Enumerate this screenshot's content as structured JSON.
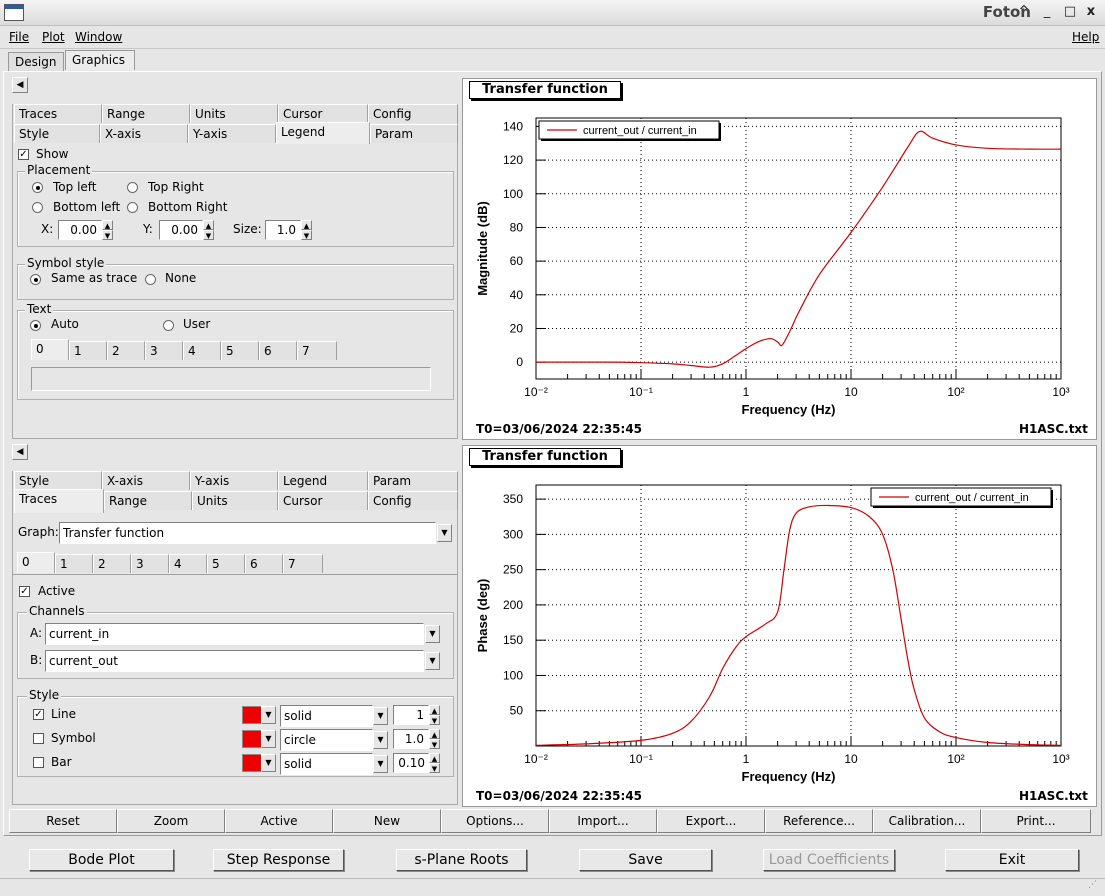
{
  "window": {
    "title": "Foton",
    "min_icon": "^",
    "minimize_icon": "_",
    "maximize_icon": "□",
    "close_icon": "x"
  },
  "menu": {
    "file": "File",
    "plot": "Plot",
    "window": "Window",
    "help": "Help"
  },
  "main_tabs": [
    "Design",
    "Graphics"
  ],
  "upper_options": {
    "tabs_row1": [
      "Traces",
      "Range",
      "Units",
      "Cursor",
      "Config"
    ],
    "tabs_row2": [
      "Style",
      "X-axis",
      "Y-axis",
      "Legend",
      "Param"
    ],
    "show_label": "Show",
    "placement": {
      "label": "Placement",
      "top_left": "Top left",
      "top_right": "Top Right",
      "bottom_left": "Bottom left",
      "bottom_right": "Bottom Right",
      "x_label": "X:",
      "x_value": "0.00",
      "y_label": "Y:",
      "y_value": "0.00",
      "size_label": "Size:",
      "size_value": "1.0"
    },
    "symbol_style": {
      "label": "Symbol style",
      "same": "Same as trace",
      "none": "None"
    },
    "text": {
      "label": "Text",
      "auto": "Auto",
      "user": "User",
      "tabs": [
        "0",
        "1",
        "2",
        "3",
        "4",
        "5",
        "6",
        "7"
      ]
    }
  },
  "lower_options": {
    "tabs_row1": [
      "Style",
      "X-axis",
      "Y-axis",
      "Legend",
      "Param"
    ],
    "tabs_row2": [
      "Traces",
      "Range",
      "Units",
      "Cursor",
      "Config"
    ],
    "graph_label": "Graph:",
    "graph_value": "Transfer function",
    "trace_tabs": [
      "0",
      "1",
      "2",
      "3",
      "4",
      "5",
      "6",
      "7"
    ],
    "active_label": "Active",
    "channels": {
      "label": "Channels",
      "a_label": "A:",
      "a_value": "current_in",
      "b_label": "B:",
      "b_value": "current_out"
    },
    "style": {
      "label": "Style",
      "line_label": "Line",
      "line_type": "solid",
      "line_width": "1",
      "symbol_label": "Symbol",
      "symbol_type": "circle",
      "symbol_size": "1.0",
      "bar_label": "Bar",
      "bar_type": "solid",
      "bar_width": "0.10"
    }
  },
  "plots": {
    "top": {
      "title": "Transfer function",
      "legend": "current_out / current_in",
      "ylabel": "Magnitude (dB)",
      "xlabel": "Frequency (Hz)",
      "t0": "T0=03/06/2024 22:35:45",
      "file": "H1ASC.txt"
    },
    "bottom": {
      "title": "Transfer function",
      "legend": "current_out / current_in",
      "ylabel": "Phase (deg)",
      "xlabel": "Frequency (Hz)",
      "t0": "T0=03/06/2024 22:35:45",
      "file": "H1ASC.txt"
    }
  },
  "chart_data": [
    {
      "type": "line",
      "xscale": "log",
      "xlim": [
        0.01,
        1000
      ],
      "ylim": [
        -10,
        145
      ],
      "yticks": [
        0,
        20,
        40,
        60,
        80,
        100,
        120,
        140
      ],
      "xticks": [
        "10⁻²",
        "10⁻¹",
        "1",
        "10",
        "10²",
        "10³"
      ],
      "grid": true,
      "legend_position": "top-left",
      "color": "#d40000",
      "series": [
        {
          "name": "current_out / current_in",
          "x": [
            0.01,
            0.05,
            0.1,
            0.2,
            0.3,
            0.45,
            0.6,
            0.8,
            1.0,
            1.3,
            1.7,
            2.0,
            2.2,
            2.6,
            3.2,
            5,
            10,
            20,
            35,
            45,
            60,
            100,
            200,
            500,
            1000
          ],
          "y": [
            0,
            0,
            -0.3,
            -1,
            -2,
            -3,
            -1,
            4,
            8,
            12,
            14,
            12,
            10,
            18,
            30,
            52,
            77,
            104,
            128,
            137,
            133,
            129,
            127,
            126.5,
            126.5
          ]
        }
      ]
    },
    {
      "type": "line",
      "xscale": "log",
      "xlim": [
        0.01,
        1000
      ],
      "ylim": [
        0,
        370
      ],
      "yticks": [
        50,
        100,
        150,
        200,
        250,
        300,
        350
      ],
      "xticks": [
        "10⁻²",
        "10⁻¹",
        "1",
        "10",
        "10²",
        "10³"
      ],
      "grid": true,
      "legend_position": "top-right",
      "color": "#d40000",
      "series": [
        {
          "name": "current_out / current_in",
          "x": [
            0.01,
            0.03,
            0.1,
            0.2,
            0.3,
            0.45,
            0.6,
            0.8,
            1.0,
            1.5,
            2.0,
            2.3,
            2.6,
            3.0,
            4,
            6,
            10,
            15,
            20,
            25,
            30,
            35,
            40,
            50,
            70,
            100,
            200,
            500,
            1000
          ],
          "y": [
            1,
            3,
            8,
            18,
            35,
            70,
            110,
            140,
            155,
            172,
            190,
            250,
            305,
            330,
            339,
            341,
            338,
            325,
            300,
            250,
            180,
            120,
            80,
            40,
            20,
            12,
            5,
            2,
            1
          ]
        }
      ]
    }
  ],
  "plot_toolbar": [
    "Reset",
    "Zoom",
    "Active",
    "New",
    "Options...",
    "Import...",
    "Export...",
    "Reference...",
    "Calibration...",
    "Print..."
  ],
  "bottom_buttons": [
    "Bode Plot",
    "Step Response",
    "s-Plane Roots",
    "Save",
    "Load Coefficients",
    "Exit"
  ]
}
